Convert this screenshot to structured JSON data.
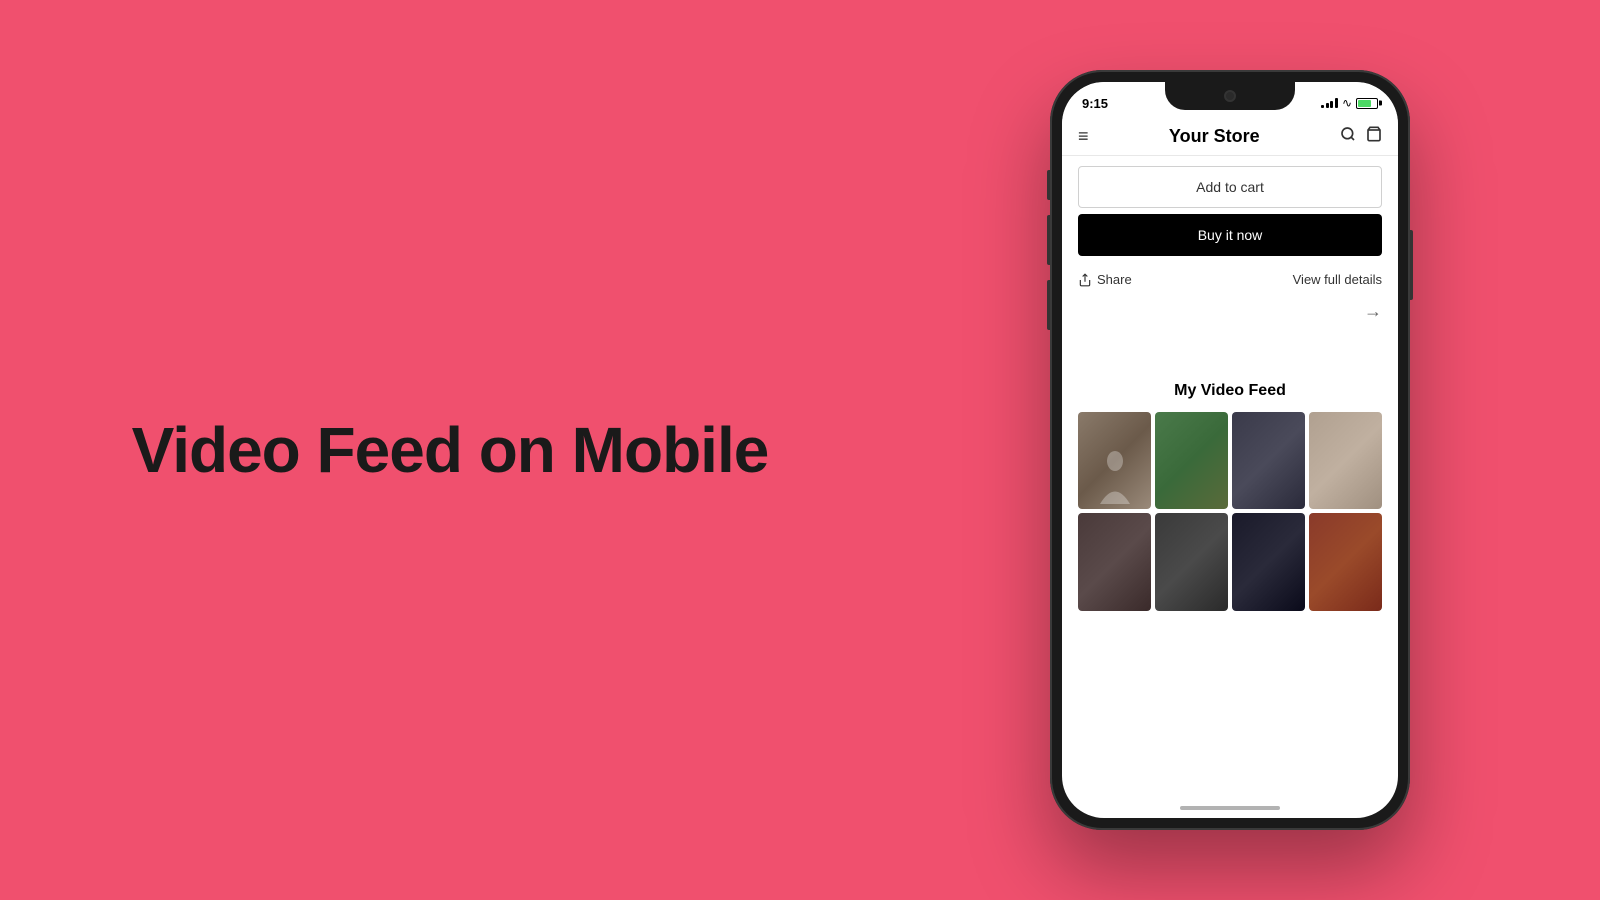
{
  "page": {
    "background_color": "#f0506e",
    "hero_text": "Video Feed on Mobile"
  },
  "phone": {
    "status": {
      "time": "9:15",
      "location_icon": "▶"
    },
    "header": {
      "title": "Your Store",
      "menu_icon": "≡",
      "search_icon": "🔍",
      "cart_icon": "🛍"
    },
    "buttons": {
      "add_to_cart": "Add to cart",
      "buy_it_now": "Buy it now"
    },
    "actions": {
      "share": "Share",
      "view_full_details": "View full details"
    },
    "video_feed": {
      "title": "My Video Feed",
      "thumbnails": [
        {
          "id": 1,
          "class": "thumb-1"
        },
        {
          "id": 2,
          "class": "thumb-2"
        },
        {
          "id": 3,
          "class": "thumb-3"
        },
        {
          "id": 4,
          "class": "thumb-4"
        },
        {
          "id": 5,
          "class": "thumb-5"
        },
        {
          "id": 6,
          "class": "thumb-6"
        },
        {
          "id": 7,
          "class": "thumb-7"
        },
        {
          "id": 8,
          "class": "thumb-8"
        }
      ]
    }
  }
}
